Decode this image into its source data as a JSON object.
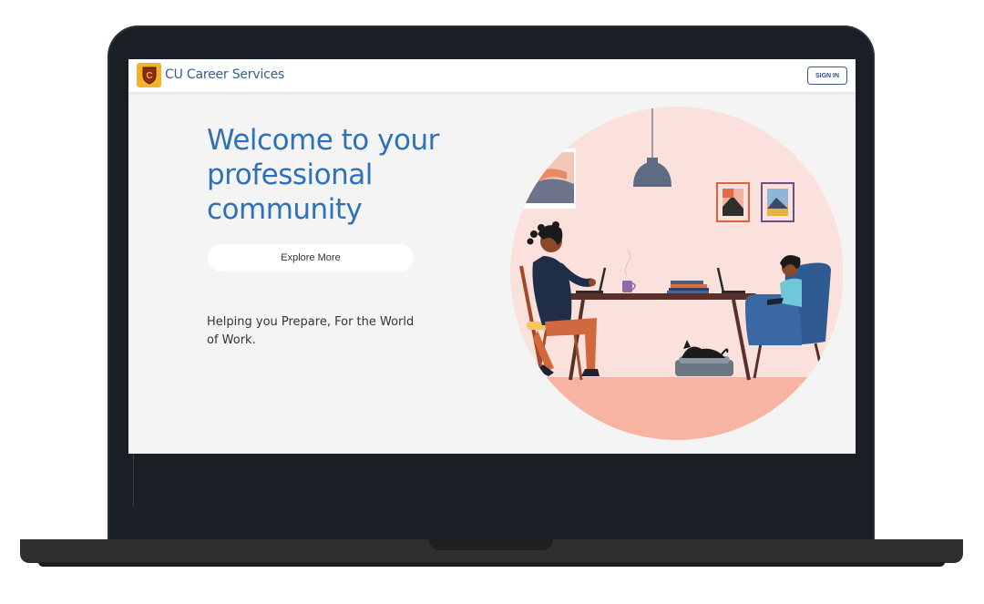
{
  "header": {
    "brand_name": "CU Career Services",
    "logo_icon": "cu-shield-logo",
    "signin_label": "SIGN IN"
  },
  "hero": {
    "headline_line1": "Welcome to your",
    "headline_line2": "professional community",
    "explore_label": "Explore More",
    "tagline": "Helping you Prepare, For the World of Work."
  },
  "colors": {
    "accent_blue": "#2d72b9",
    "logo_gold": "#f2b22a",
    "illustration_bg": "#fbe1dc",
    "floor": "#f8b4a2"
  }
}
